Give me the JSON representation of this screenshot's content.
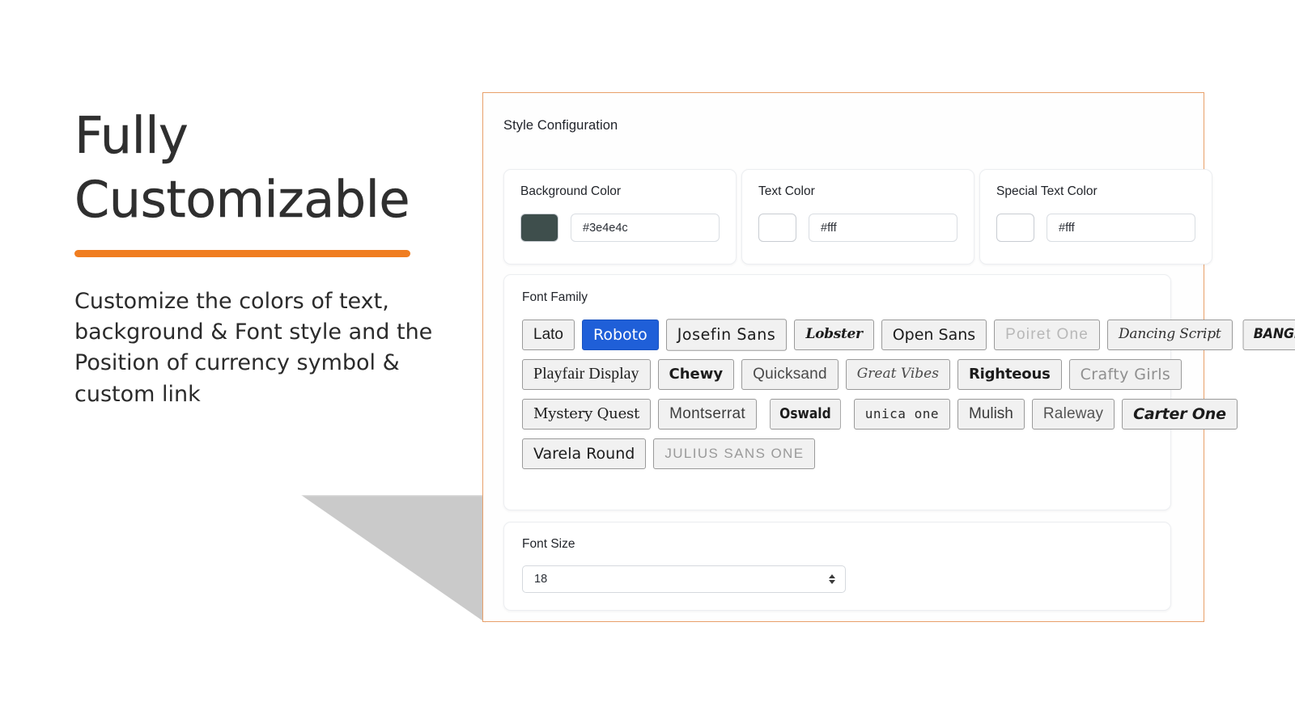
{
  "promo": {
    "title_line1": "Fully",
    "title_line2": "Customizable",
    "body": "Customize the colors of text, background & Font style and the Position of currency symbol & custom link",
    "accent_color": "#f07d20"
  },
  "panel": {
    "title": "Style Configuration",
    "frame_color": "#e8a06a"
  },
  "colors": {
    "cards": [
      {
        "label": "Background Color",
        "value": "#3e4e4c",
        "swatch": "#3e4e4c"
      },
      {
        "label": "Text Color",
        "value": "#fff",
        "swatch": "#ffffff"
      },
      {
        "label": "Special Text Color",
        "value": "#fff",
        "swatch": "#ffffff"
      }
    ]
  },
  "font_family": {
    "label": "Font Family",
    "selected": "Roboto",
    "selected_color": "#1f5fd8",
    "rows": [
      [
        {
          "label": "Lato",
          "style": "f-lato",
          "selected": false
        },
        {
          "label": "Roboto",
          "style": "f-roboto",
          "selected": true
        },
        {
          "label": "Josefin Sans",
          "style": "f-josefin",
          "selected": false
        },
        {
          "label": "Lobster",
          "style": "f-lobster",
          "selected": false
        },
        {
          "label": "Open Sans",
          "style": "f-opensans",
          "selected": false
        },
        {
          "label": "Poiret One",
          "style": "f-poiret",
          "selected": false
        },
        {
          "label": "Dancing Script",
          "style": "f-dancing",
          "selected": false
        },
        {
          "label": "BANGERS",
          "style": "f-bangers",
          "selected": false
        }
      ],
      [
        {
          "label": "Playfair Display",
          "style": "f-playfair",
          "selected": false
        },
        {
          "label": "Chewy",
          "style": "f-chewy",
          "selected": false
        },
        {
          "label": "Quicksand",
          "style": "f-quicksand",
          "selected": false
        },
        {
          "label": "Great Vibes",
          "style": "f-greatvibes",
          "selected": false
        },
        {
          "label": "Righteous",
          "style": "f-righteous",
          "selected": false
        },
        {
          "label": "Crafty Girls",
          "style": "f-crafty",
          "selected": false
        }
      ],
      [
        {
          "label": "Mystery Quest",
          "style": "f-mystery",
          "selected": false
        },
        {
          "label": "Montserrat",
          "style": "f-montserrat",
          "selected": false
        },
        {
          "label": "Oswald",
          "style": "f-oswald",
          "selected": false
        },
        {
          "label": "unica one",
          "style": "f-unica",
          "selected": false
        },
        {
          "label": "Mulish",
          "style": "f-mulish",
          "selected": false
        },
        {
          "label": "Raleway",
          "style": "f-raleway",
          "selected": false
        },
        {
          "label": "Carter One",
          "style": "f-carter",
          "selected": false
        }
      ],
      [
        {
          "label": "Varela Round",
          "style": "f-varela",
          "selected": false
        },
        {
          "label": "Julius Sans One",
          "style": "f-julius",
          "selected": false
        }
      ]
    ]
  },
  "font_size": {
    "label": "Font Size",
    "value": "18",
    "stepper_icon": "spinner-arrows-icon"
  }
}
